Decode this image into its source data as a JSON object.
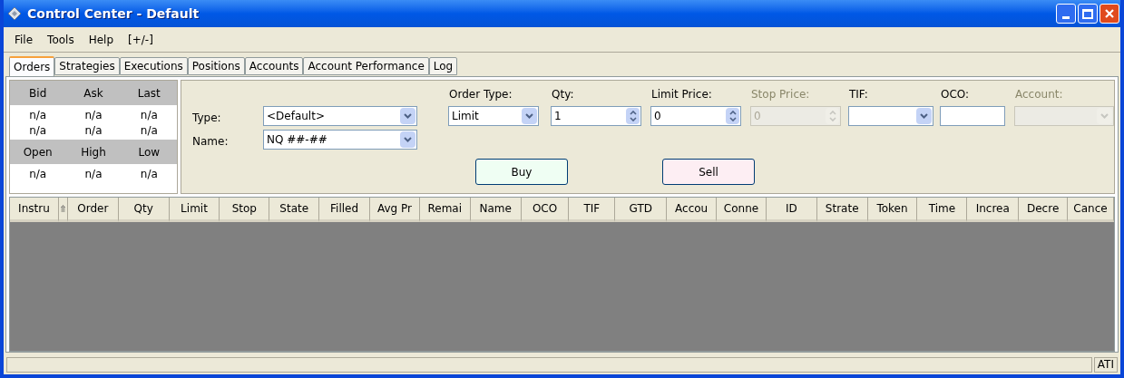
{
  "window": {
    "title": "Control Center - Default"
  },
  "menu": [
    "File",
    "Tools",
    "Help",
    "[+/-]"
  ],
  "tabs": [
    {
      "label": "Orders",
      "selected": true
    },
    {
      "label": "Strategies",
      "selected": false
    },
    {
      "label": "Executions",
      "selected": false
    },
    {
      "label": "Positions",
      "selected": false
    },
    {
      "label": "Accounts",
      "selected": false
    },
    {
      "label": "Account Performance",
      "selected": false
    },
    {
      "label": "Log",
      "selected": false
    }
  ],
  "quote": {
    "top_headers": [
      "Bid",
      "Ask",
      "Last"
    ],
    "top_rows": [
      [
        "n/a",
        "n/a",
        "n/a"
      ],
      [
        "n/a",
        "n/a",
        "n/a"
      ]
    ],
    "bottom_headers": [
      "Open",
      "High",
      "Low"
    ],
    "bottom_rows": [
      [
        "n/a",
        "n/a",
        "n/a"
      ]
    ]
  },
  "order_form": {
    "type": {
      "label": "Type:",
      "value": "<Default>"
    },
    "name": {
      "label": "Name:",
      "value": "NQ ##-##"
    },
    "fields": [
      {
        "kind": "combo",
        "label": "Order Type:",
        "value": "Limit",
        "disabled": false
      },
      {
        "kind": "spin",
        "label": "Qty:",
        "value": "1",
        "disabled": false
      },
      {
        "kind": "spin",
        "label": "Limit Price:",
        "value": "0",
        "disabled": false
      },
      {
        "kind": "spin",
        "label": "Stop Price:",
        "value": "0",
        "disabled": true
      },
      {
        "kind": "combo",
        "label": "TIF:",
        "disabled": false
      },
      {
        "kind": "text",
        "label": "OCO:",
        "disabled": false
      },
      {
        "kind": "combo",
        "label": "Account:",
        "disabled": true
      }
    ],
    "buttons": [
      {
        "kind": "buy",
        "label": "Buy"
      },
      {
        "kind": "sell",
        "label": "Sell"
      }
    ]
  },
  "table": {
    "columns": [
      "Instru",
      "",
      "Order",
      "Qty",
      "Limit",
      "Stop",
      "State",
      "Filled",
      "Avg Pr",
      "Remai",
      "Name",
      "OCO",
      "TIF",
      "GTD",
      "Accou",
      "Conne",
      "ID",
      "Strate",
      "Token",
      "Time",
      "Increa",
      "Decre",
      "Cance"
    ]
  },
  "status_bar": {
    "text": "ATI"
  }
}
